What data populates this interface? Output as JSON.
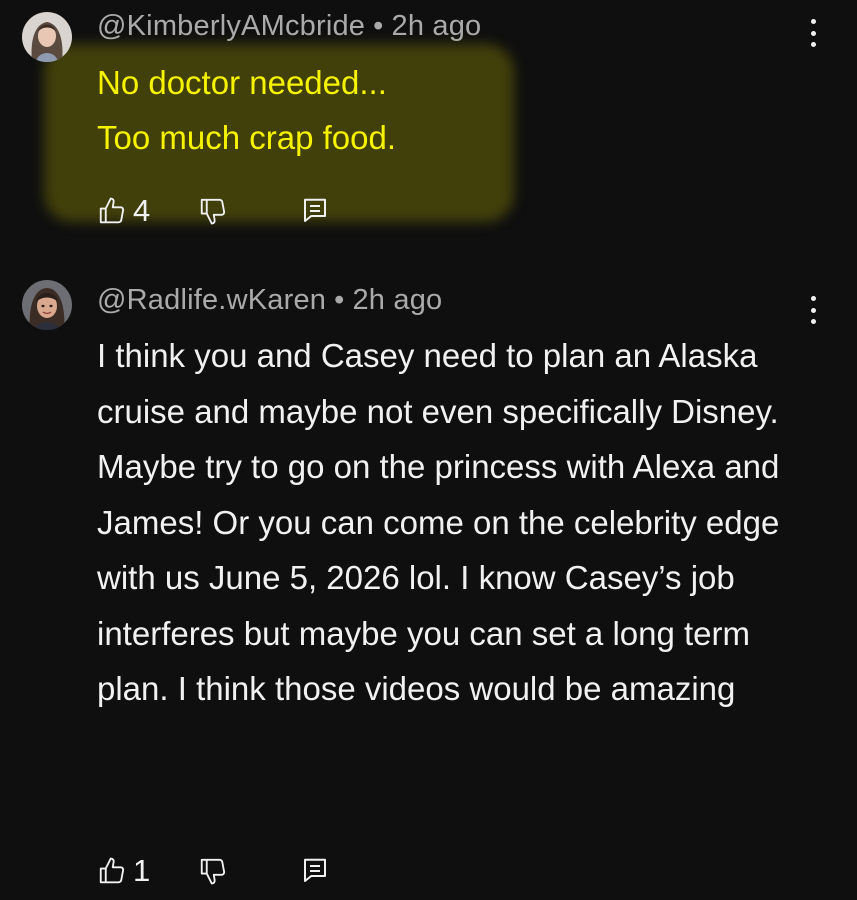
{
  "comments": [
    {
      "author": "@KimberlyAMcbride",
      "time": "2h ago",
      "text": "No doctor needed...\nToo much crap food.",
      "likes": "4",
      "highlight_color": "#f6f300"
    },
    {
      "author": "@Radlife.wKaren",
      "time": "2h ago",
      "text": "I think you and Casey need to plan an Alaska cruise and maybe not even specifically Disney. Maybe try to go on the princess with Alexa and James! Or you can come on the celebrity edge with us June 5, 2026 lol. I know Casey’s job interferes but maybe you can set a long term plan. I think those videos would be amazing",
      "likes": "1"
    }
  ],
  "separator": "•",
  "icons": {
    "like": "thumb-up-icon",
    "dislike": "thumb-down-icon",
    "reply": "reply-icon",
    "more": "more-vert-icon"
  },
  "colors": {
    "background": "#0f0f0f",
    "meta_text": "#aaaaaa",
    "body_text": "#f1f1f1"
  }
}
